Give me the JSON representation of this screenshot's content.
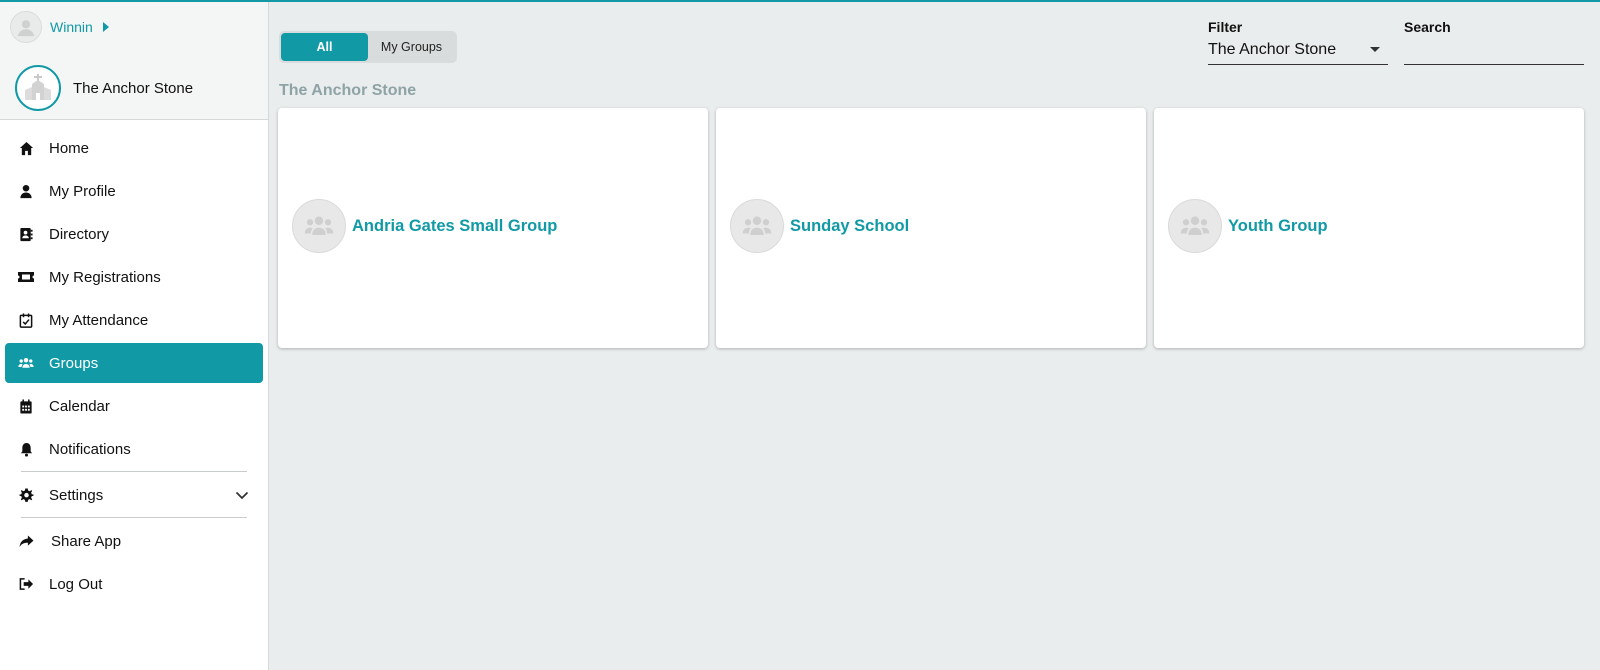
{
  "user": {
    "name": "Winnin"
  },
  "church": {
    "name": "The Anchor Stone"
  },
  "nav": {
    "home": "Home",
    "profile": "My Profile",
    "directory": "Directory",
    "registrations": "My Registrations",
    "attendance": "My Attendance",
    "groups": "Groups",
    "calendar": "Calendar",
    "notifications": "Notifications",
    "settings": "Settings",
    "share": "Share App",
    "logout": "Log Out"
  },
  "toggle": {
    "all": "All",
    "my_groups": "My Groups"
  },
  "filter": {
    "label": "Filter",
    "value": "The Anchor Stone"
  },
  "search": {
    "label": "Search",
    "value": ""
  },
  "section": {
    "title": "The Anchor Stone"
  },
  "groups": [
    {
      "name": "Andria Gates Small Group"
    },
    {
      "name": "Sunday School"
    },
    {
      "name": "Youth Group"
    }
  ],
  "colors": {
    "accent": "#119aa6",
    "background": "#eaeded",
    "section_title": "#8ea3a6"
  }
}
